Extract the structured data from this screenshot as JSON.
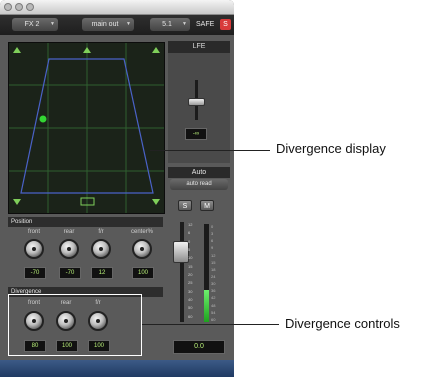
{
  "toolbar": {
    "insert_select": "FX 2",
    "output_select": "main out",
    "format_select": "5.1",
    "safe_label": "SAFE",
    "safe_button": "S"
  },
  "right_panel": {
    "lfe_label": "LFE",
    "lfe_value": "-∞",
    "auto_label": "Auto",
    "auto_mode": "auto read",
    "solo_label": "S",
    "mute_label": "M",
    "volume_value": "0.0",
    "fader_scale": [
      "12",
      "6",
      "0",
      "5",
      "10",
      "15",
      "20",
      "25",
      "30",
      "40",
      "50",
      "60"
    ],
    "meter_scale": [
      "0",
      "3",
      "6",
      "9",
      "12",
      "15",
      "18",
      "24",
      "30",
      "36",
      "42",
      "48",
      "54",
      "60"
    ],
    "meter_level_fraction": 0.33
  },
  "position": {
    "label": "Position",
    "knobs": [
      {
        "label": "front",
        "value": "-70"
      },
      {
        "label": "rear",
        "value": "-70"
      },
      {
        "label": "f/r",
        "value": "12"
      },
      {
        "label": "center%",
        "value": "100"
      }
    ]
  },
  "divergence": {
    "label": "Divergence",
    "knobs": [
      {
        "label": "front",
        "value": "80"
      },
      {
        "label": "rear",
        "value": "100"
      },
      {
        "label": "f/r",
        "value": "100"
      }
    ]
  },
  "callouts": {
    "display": "Divergence display",
    "controls": "Divergence controls"
  },
  "colors": {
    "grid_bg": "#1b2319",
    "grid_line": "#2f5f2f",
    "divergence_line": "#4a62c8",
    "pan_dot": "#33d633",
    "value_text": "#b8f078",
    "safe_red": "#d83a3a"
  }
}
